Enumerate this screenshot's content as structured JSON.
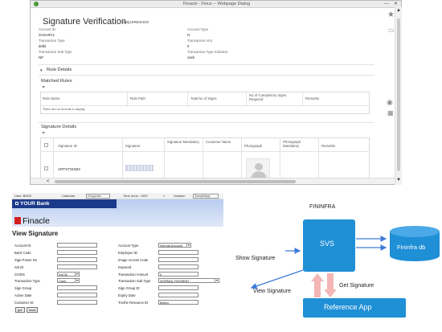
{
  "dialog": {
    "window_title": "Finacle - Finux -- Webpage Dialog",
    "title": "Signature Verification",
    "subtitle": "INQUIRESIGN",
    "fields": [
      {
        "label": "Account ID",
        "value": "SVSARC1"
      },
      {
        "label": "Account Type",
        "value": "N"
      },
      {
        "label": "Transaction Type",
        "value": "debit"
      },
      {
        "label": "Transaction Amt",
        "value": "0"
      },
      {
        "label": "Transaction Sub Type",
        "value": "NP"
      },
      {
        "label": "Transaction Type Indicator",
        "value": "cash"
      }
    ],
    "rule_details": {
      "section_title": "Rule Details",
      "matched_rules_title": "Matched Rules",
      "columns": [
        "Rule Name",
        "Rule Path",
        "Total No of Signs",
        "No of Compulsory Signs Required",
        "Remarks"
      ],
      "empty_message": "There are no records to display."
    },
    "signature_details": {
      "section_title": "Signature Details",
      "columns": [
        "Signature ID",
        "Signature",
        "Signature Mandatory",
        "Customer Name",
        "Photograph",
        "Photograph Mandatory",
        "Remarks"
      ],
      "rows": [
        {
          "signature_id": "ARTST31503"
        }
      ]
    },
    "right_icons": [
      "star-icon",
      "card-icon",
      "eye-icon",
      "calculator-icon"
    ]
  },
  "bank_app": {
    "top_bar": {
      "user": "User: BKR2",
      "calendar_label": "Calendar",
      "calendar_value": "Gregorian",
      "time_zone": "Time Zone : GMT",
      "solution_label": "Solution",
      "solution_value": "SampleApp"
    },
    "brand": "YOUR Bank",
    "product": "Finacle",
    "page_title": "View Signature",
    "left_fields": [
      {
        "label": "Account ID",
        "value": ""
      },
      {
        "label": "Bank Code",
        "value": ""
      },
      {
        "label": "Sign Power No",
        "value": ""
      },
      {
        "label": "Sol ID",
        "value": ""
      },
      {
        "label": "CIVDS",
        "value": "DoCB"
      },
      {
        "label": "Transaction Type",
        "value": "Cash"
      },
      {
        "label": "Sign Group",
        "value": ""
      },
      {
        "label": "Active Date",
        "value": ""
      },
      {
        "label": "Customer ID",
        "value": ""
      }
    ],
    "right_fields": [
      {
        "label": "Account Type",
        "value": "Normal Account"
      },
      {
        "label": "Employee ID",
        "value": ""
      },
      {
        "label": "Image Access Code",
        "value": ""
      },
      {
        "label": "Keyword",
        "value": ""
      },
      {
        "label": "Transaction Amount",
        "value": "0"
      },
      {
        "label": "Transaction Sub Type",
        "value": "NORMAL PAYMENT"
      },
      {
        "label": "Sign Group ID",
        "value": ""
      },
      {
        "label": "Expiry Date",
        "value": ""
      },
      {
        "label": "Treshe Resource ID",
        "value": "Bebra"
      }
    ],
    "buttons": {
      "get": "get",
      "back": "back"
    }
  },
  "diagram": {
    "top_label": "FININFRA",
    "svs": "SVS",
    "db": "Fininfra db",
    "show_signature": "Show Signature",
    "view_signature": "View Signature",
    "get_signature": "Get Signature",
    "reference_app": "Reference App",
    "colors": {
      "box": "#1f8fd6",
      "arrow": "#3d7bd8",
      "up_arrow": "#f4b6b6"
    }
  }
}
